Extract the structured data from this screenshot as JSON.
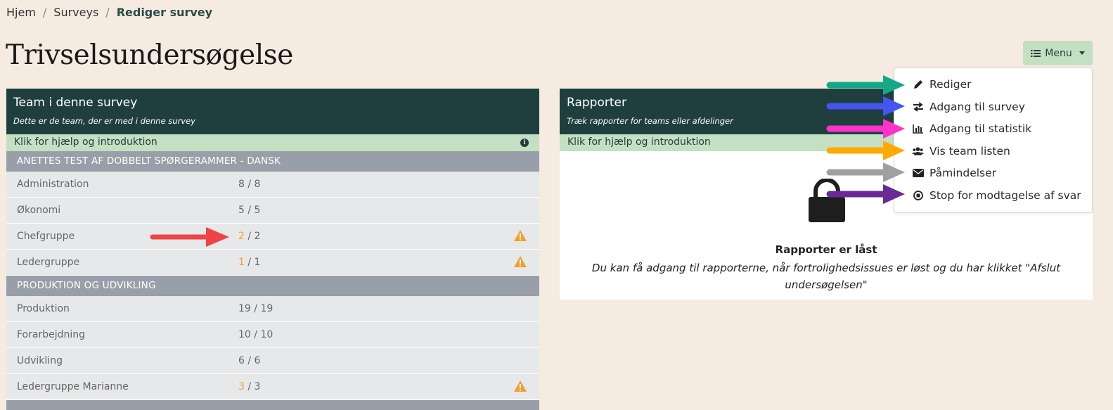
{
  "breadcrumb": {
    "home": "Hjem",
    "surveys": "Surveys",
    "current": "Rediger survey",
    "separator": "/"
  },
  "page": {
    "title": "Trivselsundersøgelse"
  },
  "menu": {
    "button_label": "Menu",
    "items": [
      {
        "label": "Rediger",
        "icon": "pencil-icon"
      },
      {
        "label": "Adgang til survey",
        "icon": "exchange-icon"
      },
      {
        "label": "Adgang til statistik",
        "icon": "bar-chart-icon"
      },
      {
        "label": "Vis team listen",
        "icon": "users-icon"
      },
      {
        "label": "Påmindelser",
        "icon": "envelope-icon"
      },
      {
        "label": "Stop for modtagelse af svar",
        "icon": "stop-circle-icon"
      }
    ]
  },
  "teams_panel": {
    "title": "Team i denne survey",
    "subtitle": "Dette er de team, der er med i denne survey",
    "help": "Klik for hjælp og introduktion",
    "groups": [
      {
        "name": "ANETTES TEST AF DOBBELT SPØRGERAMMER - DANSK",
        "rows": [
          {
            "name": "Administration",
            "answered": "8",
            "total": "8",
            "warning": false
          },
          {
            "name": "Økonomi",
            "answered": "5",
            "total": "5",
            "warning": false
          },
          {
            "name": "Chefgruppe",
            "answered": "2",
            "total": "2",
            "warning": true
          },
          {
            "name": "Ledergruppe",
            "answered": "1",
            "total": "1",
            "warning": true
          }
        ]
      },
      {
        "name": "PRODUKTION OG UDVIKLING",
        "rows": [
          {
            "name": "Produktion",
            "answered": "19",
            "total": "19",
            "warning": false
          },
          {
            "name": "Forarbejdning",
            "answered": "10",
            "total": "10",
            "warning": false
          },
          {
            "name": "Udvikling",
            "answered": "6",
            "total": "6",
            "warning": false
          },
          {
            "name": "Ledergruppe Marianne",
            "answered": "3",
            "total": "3",
            "warning": true
          }
        ]
      }
    ],
    "count_separator": " / "
  },
  "reports_panel": {
    "title": "Rapporter",
    "subtitle": "Træk rapporter for teams eller afdelinger",
    "help": "Klik for hjælp og introduktion",
    "locked_title": "Rapporter er låst",
    "locked_body": "Du kan få adgang til rapporterne, når fortrolighedsissues er løst og du har klikket \"Afslut undersøgelsen\""
  },
  "colors": {
    "header_bg": "#1f3f3f",
    "help_bg": "#c3e0c3",
    "group_bg": "#999fa9",
    "highlight": "#f0a030",
    "warning": "#f0a030",
    "arrow_green": "#14a889",
    "arrow_blue": "#4455f0",
    "arrow_pink": "#ff33cc",
    "arrow_orange": "#ffaa00",
    "arrow_gray": "#a0a0a0",
    "arrow_purple": "#6a2a96",
    "arrow_red": "#ee4444"
  }
}
